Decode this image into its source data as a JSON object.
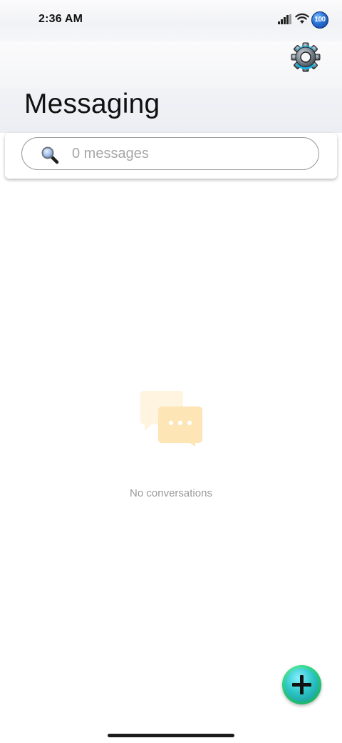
{
  "status_bar": {
    "time": "2:36 AM",
    "battery": "100",
    "icons": [
      "signal-icon",
      "wifi-icon",
      "battery-badge"
    ]
  },
  "header": {
    "title": "Messaging",
    "settings_icon": "gear-icon"
  },
  "search": {
    "placeholder": "0 messages",
    "value": "",
    "icon": "magnifier-icon"
  },
  "empty_state": {
    "icon": "chat-bubbles-icon",
    "message": "No conversations"
  },
  "fab": {
    "icon": "plus-icon",
    "color": "#2fc7c9"
  },
  "colors": {
    "header_bg": "#f1f2f5",
    "illustration": "#fde7b8",
    "fab_green": "#2ed58a"
  }
}
